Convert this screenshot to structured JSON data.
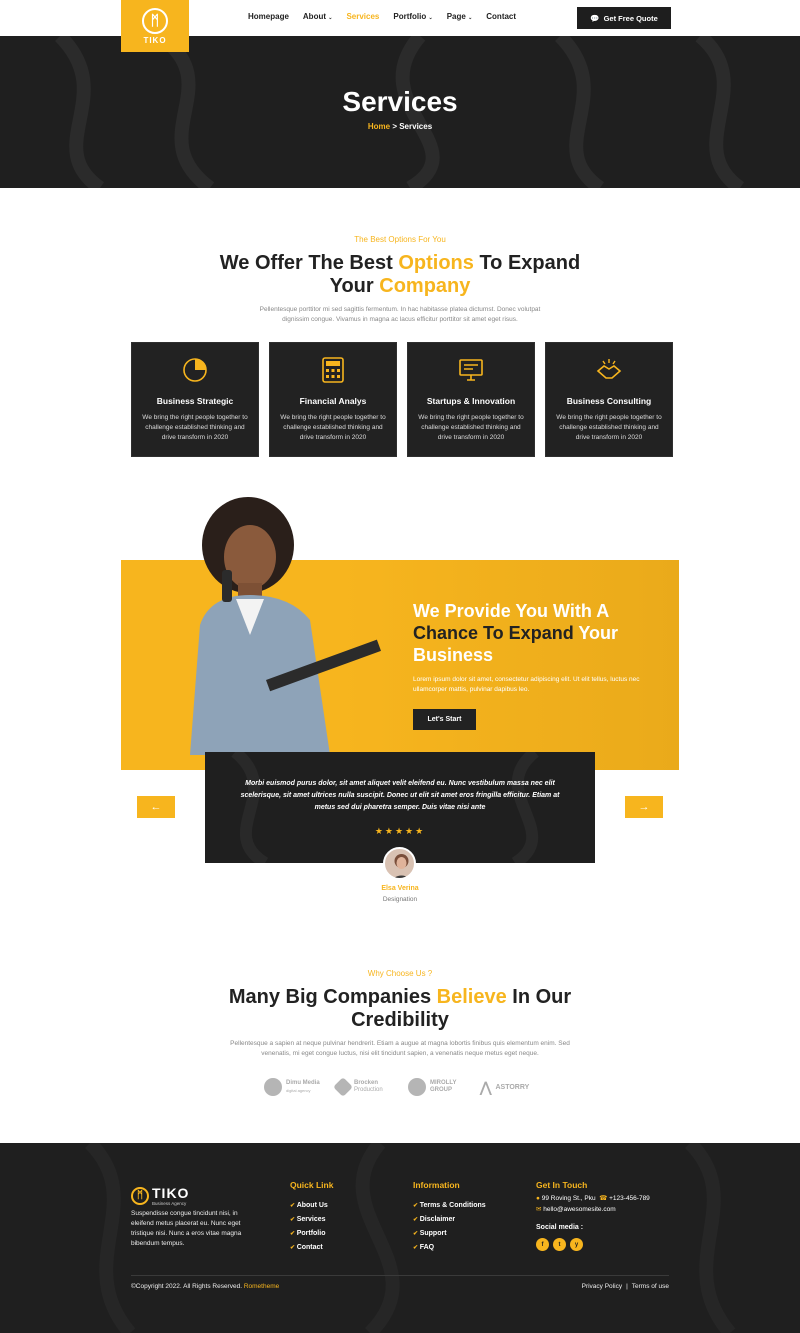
{
  "nav": {
    "logo_text": "TIKO",
    "items": [
      {
        "label": "Homepage",
        "active": false
      },
      {
        "label": "About",
        "active": false,
        "dropdown": true
      },
      {
        "label": "Services",
        "active": true
      },
      {
        "label": "Portfolio",
        "active": false,
        "dropdown": true
      },
      {
        "label": "Page",
        "active": false,
        "dropdown": true
      },
      {
        "label": "Contact",
        "active": false
      }
    ],
    "cta_label": "Get Free Quote"
  },
  "hero": {
    "title": "Services",
    "breadcrumb_home": "Home",
    "breadcrumb_sep": " > ",
    "breadcrumb_current": "Services"
  },
  "services": {
    "eyebrow": "The Best Options For You",
    "title_1": "We Offer The Best ",
    "title_accent_1": "Options",
    "title_2": " To Expand",
    "title_3": "Your ",
    "title_accent_2": "Company",
    "desc_1": "Pellentesque porttitor mi sed sagittis fermentum. In hac habitasse platea dictumst. Donec volutpat",
    "desc_2": "dignissim congue. Vivamus in magna ac lacus efficitur porttitor sit amet eget risus.",
    "cards": [
      {
        "title": "Business Strategic",
        "icon": "pie-chart-icon",
        "desc": "We bring the right people together to challenge established thinking and drive transform in 2020"
      },
      {
        "title": "Financial Analys",
        "icon": "calculator-icon",
        "desc": "We bring the right people together to challenge established thinking and drive transform in 2020"
      },
      {
        "title": "Startups & Innovation",
        "icon": "monitor-icon",
        "desc": "We bring the right people together to challenge established thinking and drive transform in 2020"
      },
      {
        "title": "Business Consulting",
        "icon": "handshake-icon",
        "desc": "We bring the right people together to challenge established thinking and drive transform in 2020"
      }
    ]
  },
  "banner": {
    "line_1": "We Provide You With A",
    "line_2a": "Chance To Expand",
    "line_2b": " Your",
    "line_3": "Business",
    "text": "Lorem ipsum dolor sit amet, consectetur adipiscing elit. Ut elit tellus, luctus nec ullamcorper mattis, pulvinar dapibus leo.",
    "button": "Let's Start"
  },
  "testimonial": {
    "quote": "Morbi euismod purus dolor, sit amet aliquet velit eleifend eu. Nunc vestibulum massa nec elit scelerisque, sit amet ultrices nulla suscipit. Donec ut elit sit amet eros fringilla efficitur. Etiam at metus sed dui pharetra semper. Duis vitae nisi ante",
    "stars": "★★★★★",
    "rating": 5,
    "name": "Elsa Verina",
    "designation": "Designation",
    "prev": "←",
    "next": "→"
  },
  "why": {
    "eyebrow": "Why Choose Us ?",
    "title_1": "Many Big Companies ",
    "title_accent": "Believe",
    "title_2": " In Our",
    "title_3": "Credibility",
    "desc_1": "Pellentesque a sapien at neque pulvinar hendrerit. Etiam a augue at magna lobortis finibus quis elementum enim. Sed",
    "desc_2": "venenatis, mi eget congue luctus, nisi elit tincidunt sapien, a venenatis neque metus eget neque.",
    "partners": [
      {
        "name": "Dimu Media",
        "sub": "digital agency"
      },
      {
        "name": "Brocken",
        "sub": "Production"
      },
      {
        "name": "MIROLLY",
        "sub": "GROUP"
      },
      {
        "name": "ASTORRY",
        "sub": ""
      }
    ]
  },
  "footer": {
    "logo": "TIKO",
    "logo_sub": "Business Agency",
    "about": "Suspendisse congue tincidunt nisi, in eleifend metus placerat eu. Nunc eget tristique nisi. Nunc a eros vitae magna bibendum tempus.",
    "quick_title": "Quick Link",
    "quick_links": [
      "About Us",
      "Services",
      "Portfolio",
      "Contact"
    ],
    "info_title": "Information",
    "info_links": [
      "Terms & Conditions",
      "Disclaimer",
      "Support",
      "FAQ"
    ],
    "touch_title": "Get In Touch",
    "address": "99 Roving St., Pku",
    "phone": "+123-456-789",
    "email": "hello@awesomesite.com",
    "social_title": "Social media :",
    "socials": [
      "f",
      "t",
      "y"
    ],
    "copyright": "©Copyright 2022. All Rights Reserved. ",
    "brand": "Rometheme",
    "privacy": "Privacy Policy",
    "terms": "Terms of use"
  }
}
